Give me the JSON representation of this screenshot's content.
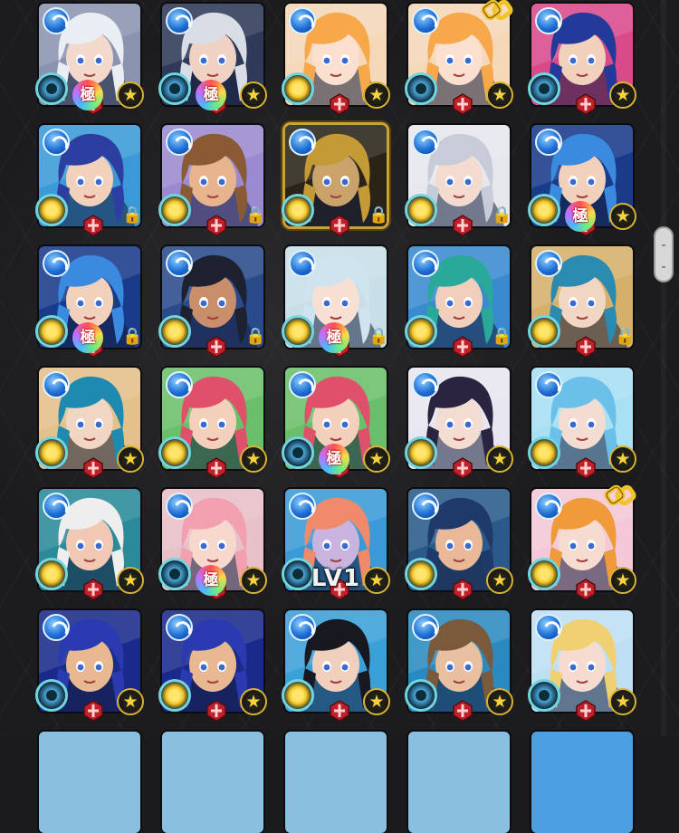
{
  "screen": "monster-box",
  "level_text": "LV1",
  "colors": {
    "element_water": "#1f6fd6",
    "star_gold": "#f7d33b",
    "gauge_cyan": "#6fd6e0",
    "background": "#1b1b1d"
  },
  "icons": {
    "element": "water-element-icon",
    "star": "star-icon",
    "lock": "lock-icon",
    "plus": "red-plus-icon",
    "kiwami": "kiwami-badge-icon",
    "chain": "chain-icon"
  },
  "kiwami_label": "極",
  "monsters": [
    {
      "hair": "#e9eef4",
      "skin": "#f3d8cc",
      "bg": "#8a94b0",
      "gauge": "ring",
      "kiwami": true,
      "lock": false,
      "chain": false
    },
    {
      "hair": "#d9dde6",
      "skin": "#efd2c4",
      "bg": "#2e3a58",
      "gauge": "ring",
      "kiwami": true,
      "lock": false,
      "chain": false
    },
    {
      "hair": "#f6a84a",
      "skin": "#fbe0cf",
      "bg": "#f4d8b8",
      "gauge": "on",
      "kiwami": false,
      "lock": false,
      "chain": false
    },
    {
      "hair": "#f6a84a",
      "skin": "#fbe0cf",
      "bg": "#f4d8b8",
      "gauge": "ring",
      "kiwami": false,
      "lock": false,
      "chain": true
    },
    {
      "hair": "#243a9a",
      "skin": "#f1d0bc",
      "bg": "#d94a8a",
      "gauge": "ring",
      "kiwami": false,
      "lock": false,
      "chain": false
    },
    {
      "hair": "#2c3fa0",
      "skin": "#f1d0bc",
      "bg": "#3a9ad8",
      "gauge": "on",
      "kiwami": false,
      "lock": true,
      "chain": false
    },
    {
      "hair": "#8a5a34",
      "skin": "#e8b48e",
      "bg": "#9a8ad0",
      "gauge": "on",
      "kiwami": false,
      "lock": true,
      "chain": false
    },
    {
      "hair": "#c49a36",
      "skin": "#c9a36a",
      "bg": "#2a2418",
      "gauge": "on",
      "kiwami": false,
      "lock": true,
      "chain": false,
      "gold": true
    },
    {
      "hair": "#c8ccd8",
      "skin": "#f3dccf",
      "bg": "#e6e8ee",
      "gauge": "on",
      "kiwami": false,
      "lock": true,
      "chain": false
    },
    {
      "hair": "#3a8ae0",
      "skin": "#f1d0bc",
      "bg": "#1a3a8a",
      "gauge": "on",
      "kiwami": true,
      "lock": false,
      "chain": false
    },
    {
      "hair": "#3a8ae0",
      "skin": "#f1d0bc",
      "bg": "#1a3a8a",
      "gauge": "on",
      "kiwami": true,
      "lock": true,
      "chain": false
    },
    {
      "hair": "#1e2230",
      "skin": "#c98e6a",
      "bg": "#2a4a8a",
      "gauge": "on",
      "kiwami": false,
      "lock": true,
      "chain": false
    },
    {
      "hair": "#cfe4ee",
      "skin": "#f6e0d4",
      "bg": "#c8dfe8",
      "gauge": "on",
      "kiwami": true,
      "lock": true,
      "chain": false
    },
    {
      "hair": "#2aa89a",
      "skin": "#f2cfbc",
      "bg": "#3a8ad0",
      "gauge": "on",
      "kiwami": false,
      "lock": true,
      "chain": false
    },
    {
      "hair": "#2a8ab0",
      "skin": "#f2d6c4",
      "bg": "#d4b06a",
      "gauge": "on",
      "kiwami": false,
      "lock": true,
      "chain": false
    },
    {
      "hair": "#1e8ab0",
      "skin": "#f2d6c4",
      "bg": "#e4c08a",
      "gauge": "on",
      "kiwami": false,
      "lock": false,
      "chain": false
    },
    {
      "hair": "#e0506a",
      "skin": "#f2d0bc",
      "bg": "#6ac06a",
      "gauge": "on",
      "kiwami": false,
      "lock": false,
      "chain": false
    },
    {
      "hair": "#e0506a",
      "skin": "#f2d0bc",
      "bg": "#6ac06a",
      "gauge": "ring",
      "kiwami": true,
      "lock": false,
      "chain": false
    },
    {
      "hair": "#2a2440",
      "skin": "#f3dcd2",
      "bg": "#e8e6f0",
      "gauge": "on",
      "kiwami": false,
      "lock": false,
      "chain": false
    },
    {
      "hair": "#6ac0e8",
      "skin": "#f3dcd2",
      "bg": "#a8e0f4",
      "gauge": "on",
      "kiwami": false,
      "lock": false,
      "chain": false
    },
    {
      "hair": "#eeeeee",
      "skin": "#f0c8b4",
      "bg": "#2a8a9a",
      "gauge": "on",
      "kiwami": false,
      "lock": false,
      "chain": false
    },
    {
      "hair": "#f2a0b0",
      "skin": "#f6d8cc",
      "bg": "#e8c0c8",
      "gauge": "ring",
      "kiwami": true,
      "lock": false,
      "chain": false
    },
    {
      "hair": "#f08a6a",
      "skin": "#c9b4e0",
      "bg": "#3a9ad8",
      "gauge": "ring",
      "kiwami": false,
      "lock": false,
      "chain": false,
      "lv": true
    },
    {
      "hair": "#1e3a6a",
      "skin": "#e8b898",
      "bg": "#2a5a8a",
      "gauge": "on",
      "kiwami": false,
      "lock": false,
      "chain": false
    },
    {
      "hair": "#f09a3a",
      "skin": "#f6dcd0",
      "bg": "#f4c8d8",
      "gauge": "on",
      "kiwami": false,
      "lock": false,
      "chain": true
    },
    {
      "hair": "#2a3ab0",
      "skin": "#e8b890",
      "bg": "#1a2a8a",
      "gauge": "ring",
      "kiwami": false,
      "lock": false,
      "chain": false
    },
    {
      "hair": "#2a3ab0",
      "skin": "#e8b890",
      "bg": "#1a2a8a",
      "gauge": "on",
      "kiwami": false,
      "lock": false,
      "chain": false
    },
    {
      "hair": "#181820",
      "skin": "#f0d0bc",
      "bg": "#3aa0d8",
      "gauge": "on",
      "kiwami": false,
      "lock": false,
      "chain": false
    },
    {
      "hair": "#7a5a3a",
      "skin": "#e8c0a0",
      "bg": "#2a8ac0",
      "gauge": "ring",
      "kiwami": false,
      "lock": false,
      "chain": false
    },
    {
      "hair": "#f0d070",
      "skin": "#f6dcd0",
      "bg": "#bfe0f4",
      "gauge": "ring",
      "kiwami": false,
      "lock": false,
      "chain": false
    }
  ]
}
